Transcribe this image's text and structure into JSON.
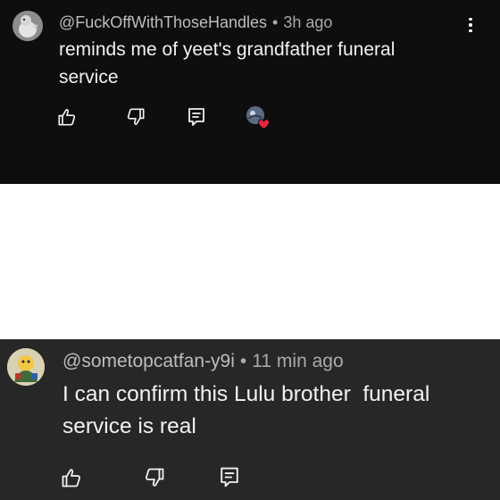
{
  "comments": [
    {
      "handle": "@FuckOffWithThoseHandles",
      "separator": "•",
      "time": "3h ago",
      "text": "reminds me of yeet's grandfather funeral service",
      "icons": [
        "like-icon",
        "dislike-icon",
        "reply-icon",
        "creator-heart-icon"
      ],
      "has_menu": true,
      "has_creator_heart": true
    },
    {
      "handle": "@sometopcatfan-y9i",
      "separator": "•",
      "time": "11 min ago",
      "text": "I can confirm this Lulu brother  funeral service is real",
      "icons": [
        "like-icon",
        "dislike-icon",
        "reply-icon"
      ],
      "has_menu": false,
      "has_creator_heart": false
    }
  ],
  "colors": {
    "top_background": "#0e0e0e",
    "bottom_background": "#272727",
    "gap_background": "#ffffff",
    "text": "#f1f1f1",
    "meta": "#aaaaaa",
    "heart": "#e8263f"
  }
}
